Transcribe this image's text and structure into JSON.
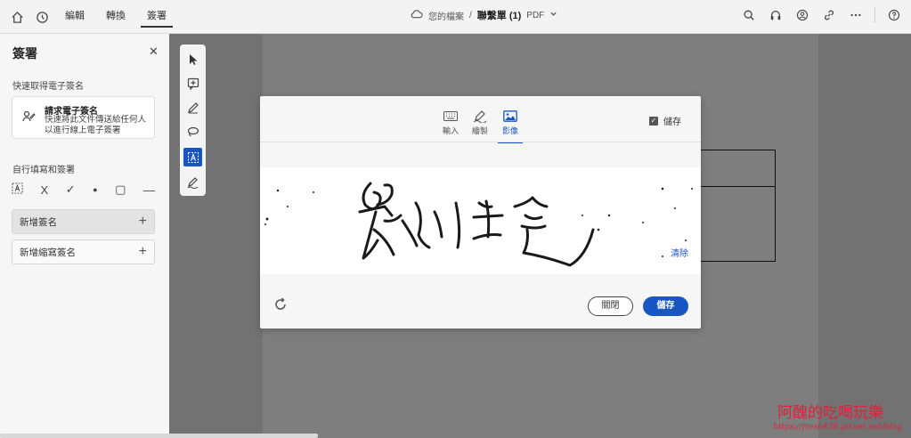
{
  "topbar": {
    "tabs": [
      "編輯",
      "轉換",
      "簽署"
    ],
    "active_tab": "簽署",
    "breadcrumb": "您的檔案",
    "separator": "/",
    "file_name": "聯繫單 (1)",
    "file_type": "PDF"
  },
  "panel": {
    "title": "簽署",
    "quick_label": "快速取得電子簽名",
    "request": {
      "title": "請求電子簽名",
      "desc": "快速將此文件傳送給任何人以進行線上電子簽署"
    },
    "self_label": "自行填寫和簽署",
    "tool_glyphs": [
      "A",
      "X",
      "✓",
      "●",
      "▢",
      "—"
    ],
    "add_signature": "新增簽名",
    "add_initials": "新增縮寫簽名",
    "plus": "+"
  },
  "modal": {
    "tabs": [
      "輸入",
      "繪製",
      "影像"
    ],
    "active_tab": "影像",
    "save_label": "儲存",
    "clear": "清除",
    "close_button": "關閉",
    "save_button": "儲存",
    "checked": true
  },
  "watermark": {
    "line1": "阿醜的吃喝玩樂",
    "line2": "https://fresh438.pixnet.net/blog"
  },
  "colors": {
    "accent": "#1a56c2",
    "watermark": "#e0203a"
  }
}
